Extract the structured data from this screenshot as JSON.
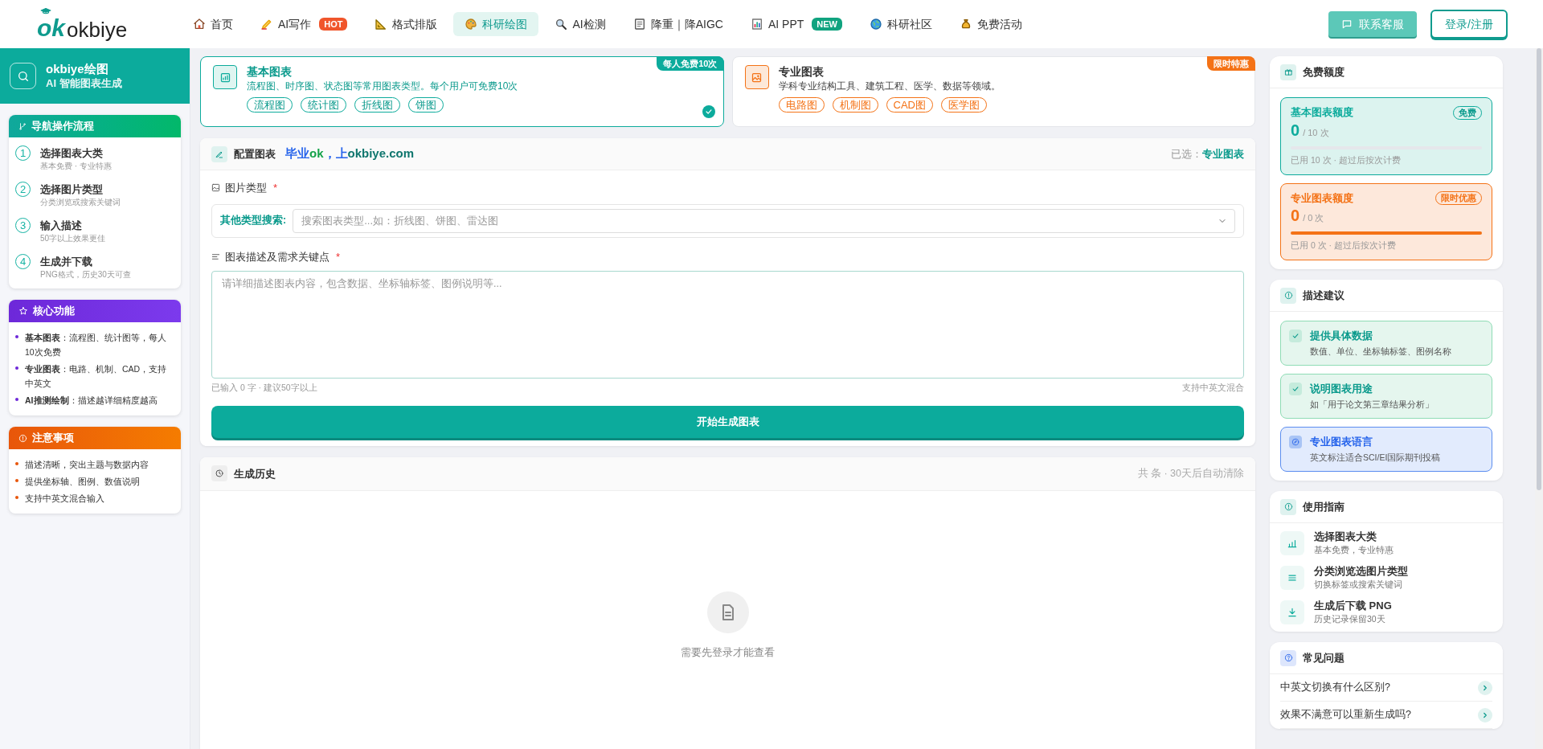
{
  "brand": {
    "logo_mark": "ok",
    "name": "okbiye"
  },
  "nav": [
    {
      "label": "首页",
      "selected": false
    },
    {
      "label": "AI写作",
      "selected": false,
      "badge": "HOT",
      "color": "#f0552b"
    },
    {
      "label": "格式排版",
      "selected": false
    },
    {
      "label": "科研绘图",
      "selected": true
    },
    {
      "label": "AI检测",
      "selected": false
    },
    {
      "label": "降重｜降AIGC",
      "selected": false
    },
    {
      "label": "AI PPT",
      "selected": false,
      "badge": "NEW",
      "color": "#10a37f"
    },
    {
      "label": "科研社区",
      "selected": false
    },
    {
      "label": "免费活动",
      "selected": false
    }
  ],
  "header_buttons": {
    "service": "联系客服",
    "login": "登录/注册"
  },
  "sidebar": {
    "title": "okbiye绘图",
    "subtitle": "AI 智能图表生成",
    "flow": {
      "title": "导航操作流程",
      "steps": [
        {
          "num": "1",
          "title": "选择图表大类",
          "desc": "基本免费 · 专业特惠"
        },
        {
          "num": "2",
          "title": "选择图片类型",
          "desc": "分类浏览或搜索关键词"
        },
        {
          "num": "3",
          "title": "输入描述",
          "desc": "50字以上效果更佳"
        },
        {
          "num": "4",
          "title": "生成并下载",
          "desc": "PNG格式，历史30天可查"
        }
      ]
    },
    "features": {
      "title": "核心功能",
      "items": [
        "**基本图表**：流程图、统计图等，每人10次免费",
        "**专业图表**：电路、机制、CAD，支持中英文",
        "**AI推测绘制**：描述越详细精度越高"
      ]
    },
    "notes": {
      "title": "注意事项",
      "items": [
        "描述清晰，突出主题与数据内容",
        "提供坐标轴、图例、数值说明",
        "支持中英文混合输入"
      ]
    }
  },
  "chart_types": [
    {
      "kind": "basic",
      "title": "基本图表",
      "desc": "流程图、时序图、状态图等常用图表类型。每个用户可免费10次",
      "ribbon": "每人免费10次",
      "tags": [
        "流程图",
        "统计图",
        "折线图",
        "饼图"
      ],
      "selected": true
    },
    {
      "kind": "pro",
      "title": "专业图表",
      "desc": "学科专业结构工具、建筑工程、医学、数据等领域。",
      "ribbon": "限时特惠",
      "tags": [
        "电路图",
        "机制图",
        "CAD图",
        "医学图"
      ],
      "selected": false
    }
  ],
  "config": {
    "title": "配置图表",
    "slogan": [
      {
        "text": "毕业",
        "color": "#2563eb"
      },
      {
        "text": "ok",
        "color": "#16a34a"
      },
      {
        "text": "，上",
        "color": "#2563eb"
      },
      {
        "text": "okbiye.com",
        "color": "#0f766e"
      }
    ],
    "selected_label": "已选：",
    "selected_value": "专业图表",
    "type_label": "图片类型",
    "search_label": "其他类型搜索:",
    "search_placeholder": "搜索图表类型...如：折线图、饼图、雷达图",
    "desc_label": "图表描述及需求关键点",
    "desc_placeholder": "请详细描述图表内容，包含数据、坐标轴标签、图例说明等...",
    "counter": "已输入 0 字 · 建议50字以上",
    "mixed": "支持中英文混合",
    "required_mark": "*",
    "generate": "开始生成图表"
  },
  "history": {
    "title": "生成历史",
    "meta": "共 条 · 30天后自动清除",
    "empty": "需要先登录才能查看"
  },
  "quota": {
    "title": "免费额度",
    "items": [
      {
        "kind": "basic",
        "title": "基本图表额度",
        "badge": "免费",
        "count": "0",
        "total": "/ 10 次",
        "level": 0,
        "note": "已用 10 次 · 超过后按次计费"
      },
      {
        "kind": "pro",
        "title": "专业图表额度",
        "badge": "限时优惠",
        "count": "0",
        "total": "/ 0 次",
        "level": 1,
        "note": "已用 0 次 · 超过后按次计费"
      }
    ]
  },
  "tips": {
    "title": "描述建议",
    "items": [
      {
        "kind": "check",
        "title": "提供具体数据",
        "desc": "数值、单位、坐标轴标签、图例名称"
      },
      {
        "kind": "check",
        "title": "说明图表用途",
        "desc": "如「用于论文第三章结果分析」"
      },
      {
        "kind": "compass",
        "title": "专业图表语言",
        "desc": "英文标注适合SCI/EI国际期刊投稿"
      }
    ]
  },
  "guide": {
    "title": "使用指南",
    "items": [
      {
        "title": "选择图表大类",
        "desc": "基本免费，专业特惠"
      },
      {
        "title": "分类浏览选图片类型",
        "desc": "切换标签或搜索关键词"
      },
      {
        "title": "生成后下载 PNG",
        "desc": "历史记录保留30天"
      }
    ]
  },
  "faq": {
    "title": "常见问题",
    "items": [
      "中英文切换有什么区别?",
      "效果不满意可以重新生成吗?"
    ]
  }
}
